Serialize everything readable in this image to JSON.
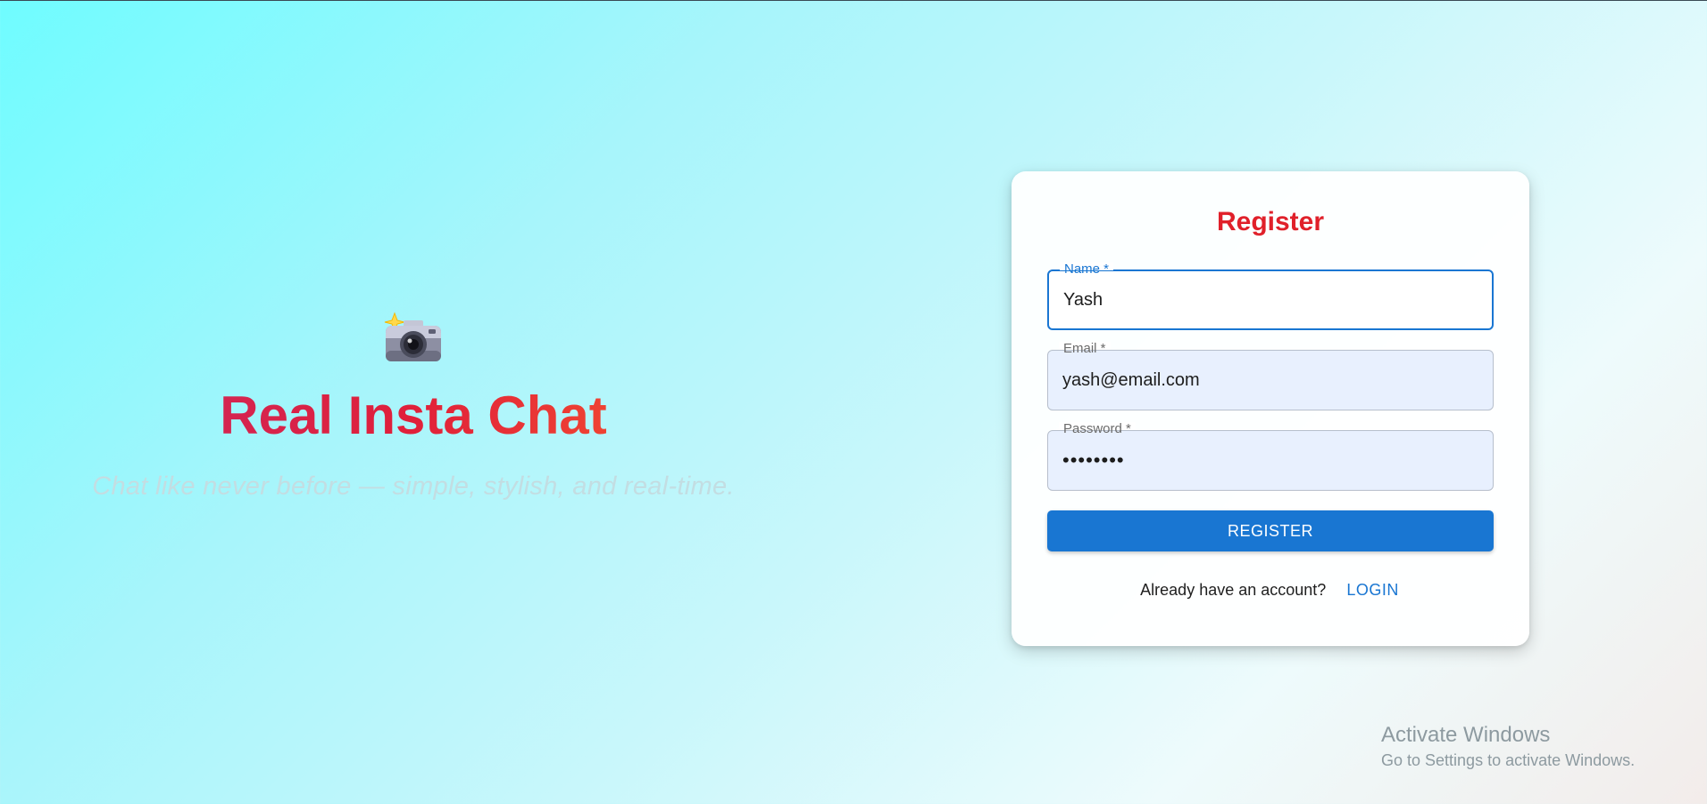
{
  "hero": {
    "icon": "camera-with-flash-icon",
    "title": "Real Insta Chat",
    "subtitle": "Chat like never before — simple, stylish, and real-time."
  },
  "form": {
    "title": "Register",
    "fields": {
      "name": {
        "label": "Name *",
        "value": "Yash",
        "state": "focused"
      },
      "email": {
        "label": "Email *",
        "value": "yash@email.com",
        "state": "autofilled"
      },
      "password": {
        "label": "Password *",
        "value": "••••••••",
        "state": "autofilled"
      }
    },
    "submit_label": "REGISTER",
    "login_prompt": "Already have an account?",
    "login_label": "LOGIN"
  },
  "watermark": {
    "title": "Activate Windows",
    "subtitle": "Go to Settings to activate Windows."
  },
  "colors": {
    "accent": "#1976d2",
    "title_red": "#e0202a",
    "autofill_bg": "#e8f0fe"
  }
}
